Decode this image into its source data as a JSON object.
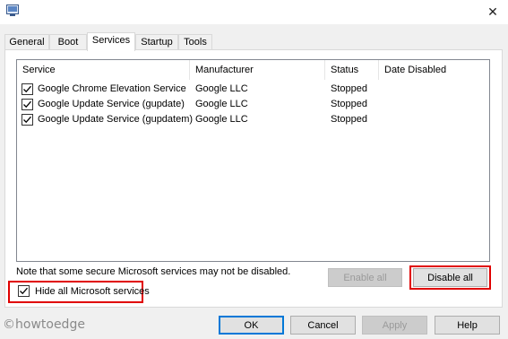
{
  "window": {
    "close_glyph": "✕"
  },
  "tabs": [
    {
      "label": "General"
    },
    {
      "label": "Boot"
    },
    {
      "label": "Services",
      "active": true
    },
    {
      "label": "Startup"
    },
    {
      "label": "Tools"
    }
  ],
  "services_table": {
    "columns": [
      "Service",
      "Manufacturer",
      "Status",
      "Date Disabled"
    ],
    "rows": [
      {
        "checked": true,
        "service": "Google Chrome Elevation Service",
        "manufacturer": "Google LLC",
        "status": "Stopped",
        "date_disabled": ""
      },
      {
        "checked": true,
        "service": "Google Update Service (gupdate)",
        "manufacturer": "Google LLC",
        "status": "Stopped",
        "date_disabled": ""
      },
      {
        "checked": true,
        "service": "Google Update Service (gupdatem)",
        "manufacturer": "Google LLC",
        "status": "Stopped",
        "date_disabled": ""
      }
    ]
  },
  "note": "Note that some secure Microsoft services may not be disabled.",
  "buttons": {
    "enable_all": "Enable all",
    "disable_all": "Disable all",
    "ok": "OK",
    "cancel": "Cancel",
    "apply": "Apply",
    "help": "Help"
  },
  "hide_ms": {
    "label": "Hide all Microsoft services",
    "checked": true
  },
  "watermark": "©howtoedge",
  "colors": {
    "highlight_box": "#e00000",
    "primary_border": "#0078d7"
  },
  "icons": {
    "app": "msconfig-icon",
    "close": "close-icon",
    "check": "checkmark-icon"
  }
}
